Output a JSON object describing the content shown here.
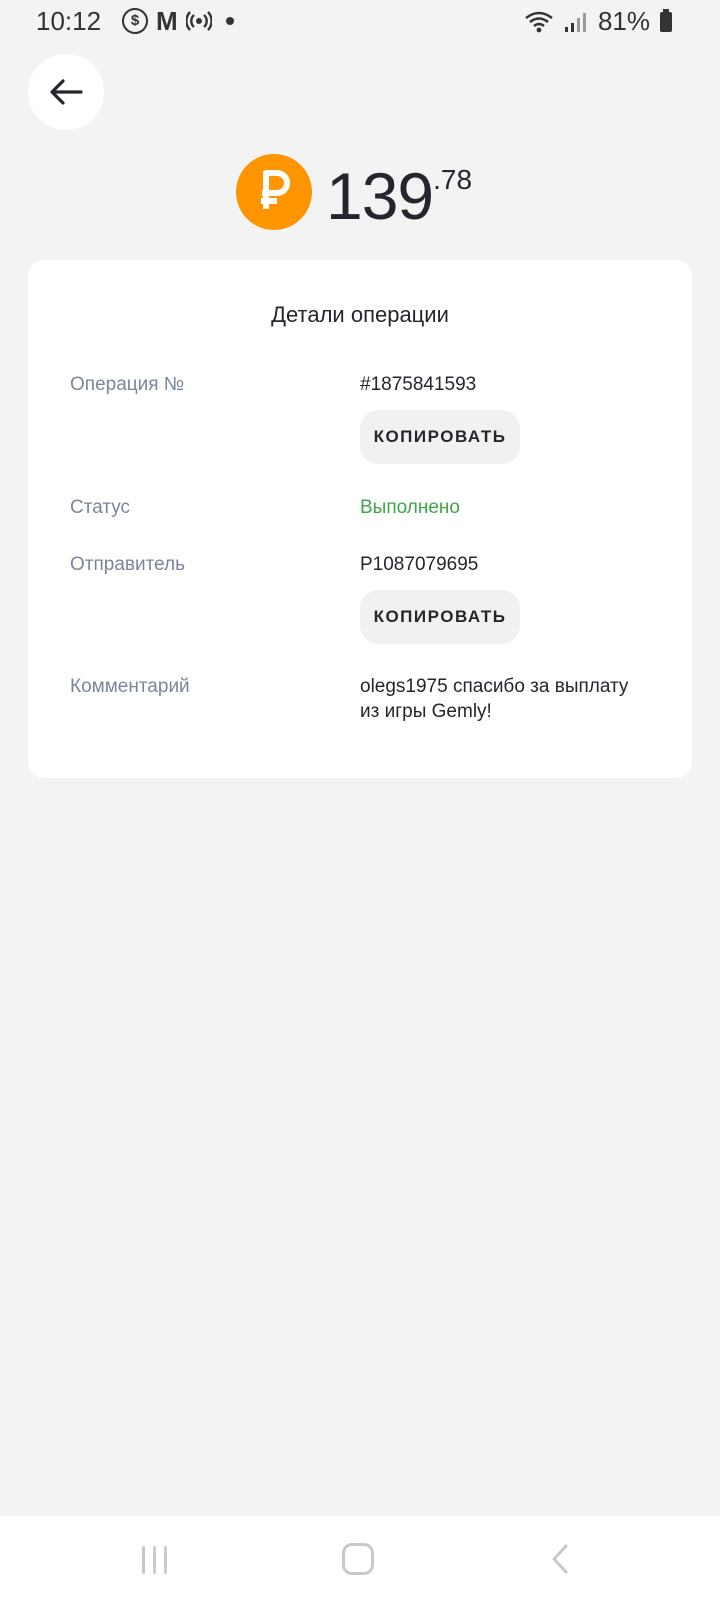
{
  "status_bar": {
    "time": "10:12",
    "notif_m": "M",
    "battery": "81%"
  },
  "amount": {
    "currency_icon": "ruble-coin-icon",
    "integer": "139",
    "fraction": ".78",
    "coin_color": "#ff9500"
  },
  "details": {
    "title": "Детали операции",
    "operation_label": "Операция №",
    "operation_value": "#1875841593",
    "copy_label": "КОПИРОВАТЬ",
    "status_label": "Статус",
    "status_value": "Выполнено",
    "status_color": "#3fa54a",
    "sender_label": "Отправитель",
    "sender_value": "P1087079695",
    "comment_label": "Комментарий",
    "comment_value": "olegs1975 спасибо за выплату из игры Gemly!"
  }
}
